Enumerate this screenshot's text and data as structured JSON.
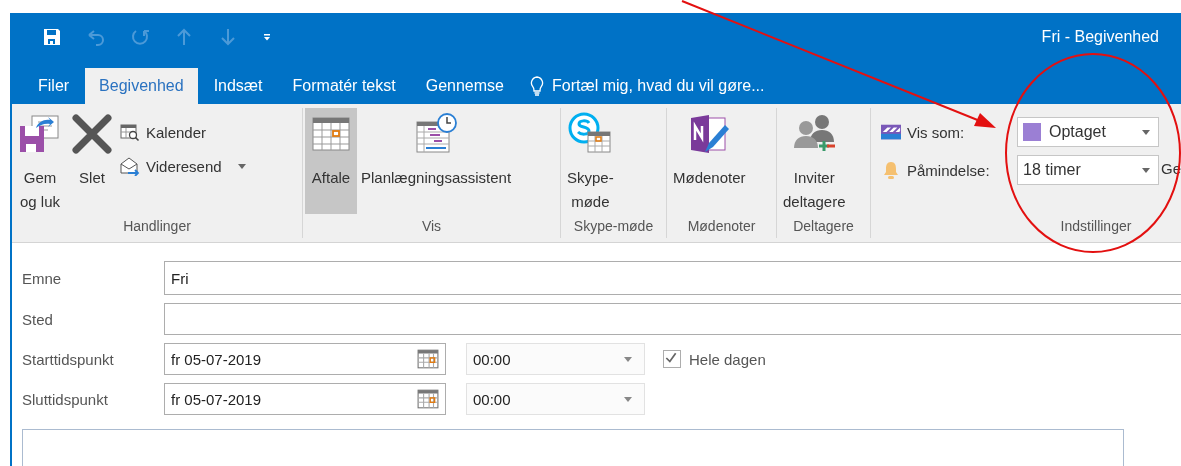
{
  "window": {
    "title": "Fri - Begivenhed"
  },
  "quick_access": [
    {
      "kind": "save",
      "disabled": false
    },
    {
      "kind": "undo",
      "disabled": true
    },
    {
      "kind": "redo",
      "disabled": true
    },
    {
      "kind": "up",
      "disabled": true
    },
    {
      "kind": "down",
      "disabled": true
    },
    {
      "kind": "customize",
      "disabled": false
    }
  ],
  "tabs": [
    {
      "label": "Filer",
      "selected": false
    },
    {
      "label": "Begivenhed",
      "selected": true
    },
    {
      "label": "Indsæt",
      "selected": false
    },
    {
      "label": "Formatér tekst",
      "selected": false
    },
    {
      "label": "Gennemse",
      "selected": false
    }
  ],
  "tell_me": "Fortæl mig, hvad du vil gøre...",
  "ribbon": [
    {
      "label": "Handlinger",
      "items": [
        {
          "kind": "large",
          "lines": [
            "Gem",
            "og luk"
          ],
          "selected": false
        },
        {
          "kind": "large",
          "lines": [
            "Slet"
          ],
          "selected": false
        },
        {
          "kind": "stack",
          "rows": [
            {
              "label": "Kalender",
              "dropdown": false
            },
            {
              "label": "Videresend",
              "dropdown": true
            }
          ]
        }
      ]
    },
    {
      "label": "Vis",
      "items": [
        {
          "kind": "large",
          "lines": [
            "Aftale"
          ],
          "selected": true
        },
        {
          "kind": "large",
          "lines": [
            "Planlægningsassistent"
          ],
          "selected": false
        }
      ]
    },
    {
      "label": "Skype-møde",
      "items": [
        {
          "kind": "large",
          "lines": [
            "Skype-",
            "møde"
          ],
          "selected": false
        }
      ]
    },
    {
      "label": "Mødenoter",
      "items": [
        {
          "kind": "large",
          "lines": [
            "Mødenoter"
          ],
          "selected": false
        }
      ]
    },
    {
      "label": "Deltagere",
      "items": [
        {
          "kind": "large",
          "lines": [
            "Inviter",
            "deltagere"
          ],
          "selected": false
        }
      ]
    },
    {
      "label": "Indstillinger",
      "items": [
        {
          "kind": "options",
          "rows": [
            {
              "label": "Vis som:",
              "value": "Optaget",
              "color": "#9b7fd4"
            },
            {
              "label": "Påmindelse:",
              "value": "18 timer"
            }
          ],
          "text": "Ge"
        }
      ]
    }
  ],
  "form": {
    "fields": [
      {
        "label": "Emne",
        "value": "Fri"
      },
      {
        "label": "Sted"
      }
    ],
    "times": [
      {
        "label": "Starttidspunkt",
        "date": "fr 05-07-2019",
        "time": "00:00",
        "all_day": {
          "label": "Hele dagen",
          "checked": true
        }
      },
      {
        "label": "Sluttidspunkt",
        "date": "fr 05-07-2019",
        "time": "00:00"
      }
    ]
  }
}
